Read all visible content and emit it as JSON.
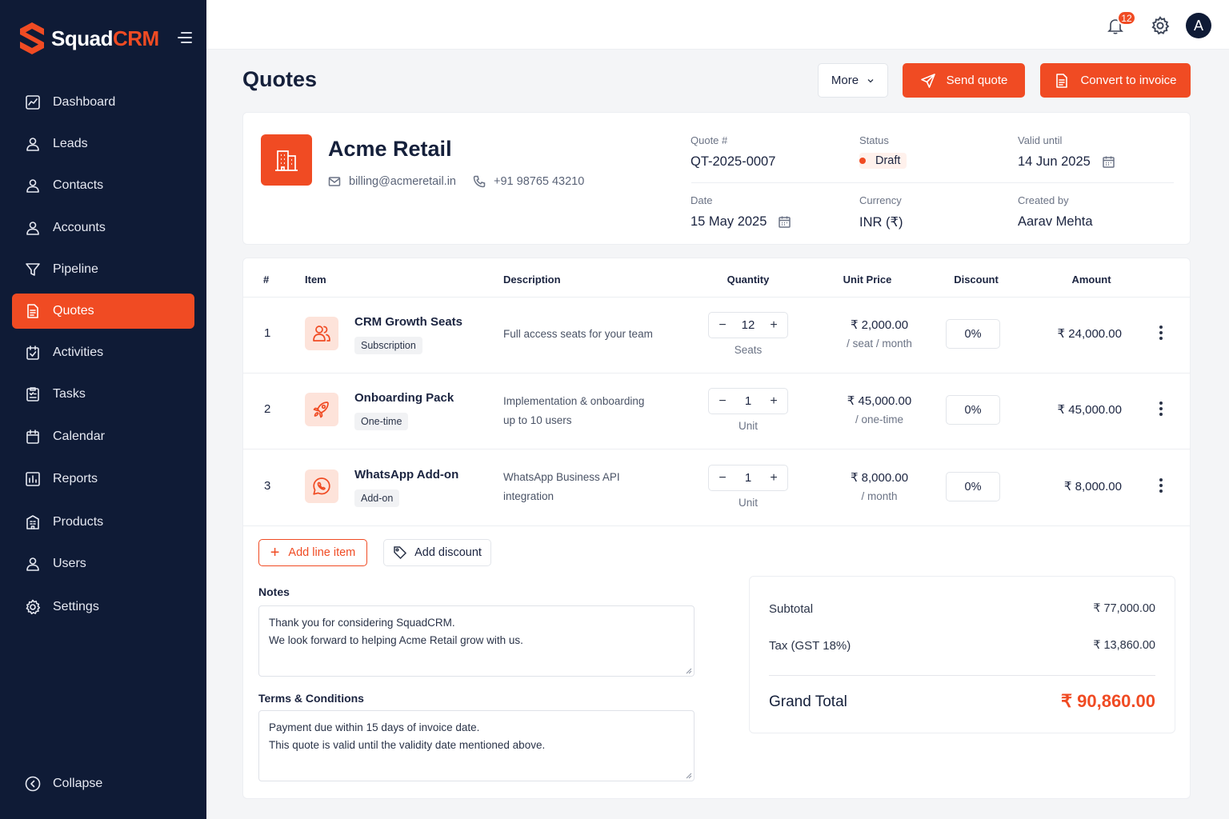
{
  "brand": {
    "name_a": "Squad",
    "name_b": "CRM"
  },
  "sidebar": {
    "items": [
      {
        "label": "Dashboard",
        "icon": "chart-line-icon"
      },
      {
        "label": "Leads",
        "icon": "user-icon"
      },
      {
        "label": "Contacts",
        "icon": "user-icon"
      },
      {
        "label": "Accounts",
        "icon": "user-icon"
      },
      {
        "label": "Pipeline",
        "icon": "funnel-icon"
      },
      {
        "label": "Quotes",
        "icon": "document-icon",
        "active": true
      },
      {
        "label": "Activities",
        "icon": "calendar-check-icon"
      },
      {
        "label": "Tasks",
        "icon": "clipboard-icon"
      },
      {
        "label": "Calendar",
        "icon": "calendar-icon"
      },
      {
        "label": "Reports",
        "icon": "bar-chart-icon"
      },
      {
        "label": "Products",
        "icon": "building-icon"
      },
      {
        "label": "Users",
        "icon": "user-icon"
      },
      {
        "label": "Settings",
        "icon": "gear-icon"
      }
    ],
    "collapse_label": "Collapse"
  },
  "topbar": {
    "notification_count": "12",
    "avatar_initial": "A"
  },
  "page": {
    "title": "Quotes",
    "more_label": "More",
    "send_label": "Send quote",
    "convert_label": "Convert to invoice"
  },
  "quote": {
    "company": "Acme Retail",
    "email": "billing@acmeretail.in",
    "phone": "+91 98765 43210",
    "quote_no_label": "Quote #",
    "quote_no": "QT-2025-0007",
    "status_label": "Status",
    "status": "Draft",
    "valid_label": "Valid until",
    "valid_until": "14 Jun 2025",
    "date_label": "Date",
    "date": "15 May 2025",
    "currency_label": "Currency",
    "currency": "INR (₹)",
    "created_label": "Created by",
    "created_by": "Aarav Mehta"
  },
  "table": {
    "headers": {
      "num": "#",
      "item": "Item",
      "description": "Description",
      "quantity": "Quantity",
      "unit_price": "Unit Price",
      "discount": "Discount",
      "amount": "Amount"
    },
    "rows": [
      {
        "num": "1",
        "name": "CRM Growth Seats",
        "tag": "Subscription",
        "icon": "users-icon",
        "desc1": "Full access seats for your team",
        "desc2": "",
        "qty": "12",
        "unit": "Seats",
        "price": "₹ 2,000.00",
        "price_sub": "/ seat / month",
        "discount": "0%",
        "amount": "₹ 24,000.00"
      },
      {
        "num": "2",
        "name": "Onboarding Pack",
        "tag": "One-time",
        "icon": "rocket-icon",
        "desc1": "Implementation & onboarding",
        "desc2": "up to 10 users",
        "qty": "1",
        "unit": "Unit",
        "price": "₹ 45,000.00",
        "price_sub": "/ one-time",
        "discount": "0%",
        "amount": "₹ 45,000.00"
      },
      {
        "num": "3",
        "name": "WhatsApp Add-on",
        "tag": "Add-on",
        "icon": "whatsapp-icon",
        "desc1": "WhatsApp Business API",
        "desc2": "integration",
        "qty": "1",
        "unit": "Unit",
        "price": "₹ 8,000.00",
        "price_sub": "/ month",
        "discount": "0%",
        "amount": "₹ 8,000.00"
      }
    ],
    "add_line_label": "Add line item",
    "add_discount_label": "Add discount"
  },
  "notes": {
    "label": "Notes",
    "line1": "Thank you for considering SquadCRM.",
    "line2": "We look forward to helping Acme Retail grow with us."
  },
  "terms": {
    "label": "Terms & Conditions",
    "line1": "Payment due within 15 days of invoice date.",
    "line2": "This quote is valid until the validity date mentioned above."
  },
  "totals": {
    "subtotal_label": "Subtotal",
    "subtotal": "₹ 77,000.00",
    "tax_label": "Tax (GST 18%)",
    "tax": "₹ 13,860.00",
    "grand_label": "Grand Total",
    "grand": "₹ 90,860.00"
  },
  "colors": {
    "accent": "#f04b23",
    "sidebar": "#0f1b36"
  }
}
